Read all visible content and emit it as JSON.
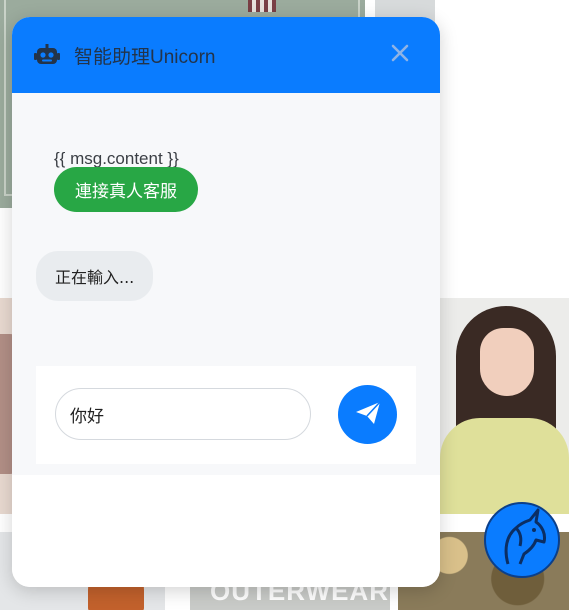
{
  "header": {
    "title": "智能助理Unicorn",
    "bot_icon": "robot-icon",
    "close_icon": "close-icon"
  },
  "messages": {
    "content_placeholder": "{{ msg.content }}",
    "human_agent_button": "連接真人客服",
    "typing_indicator": "正在輸入..."
  },
  "composer": {
    "input_value": "你好",
    "send_icon": "paper-plane-icon"
  },
  "launcher": {
    "icon": "unicorn-icon"
  },
  "background": {
    "banner_text": "OUTERWEAR"
  },
  "colors": {
    "primary": "#0a7cff",
    "success": "#28a745",
    "bubble": "#e9ecef",
    "header_text": "#23344a"
  }
}
